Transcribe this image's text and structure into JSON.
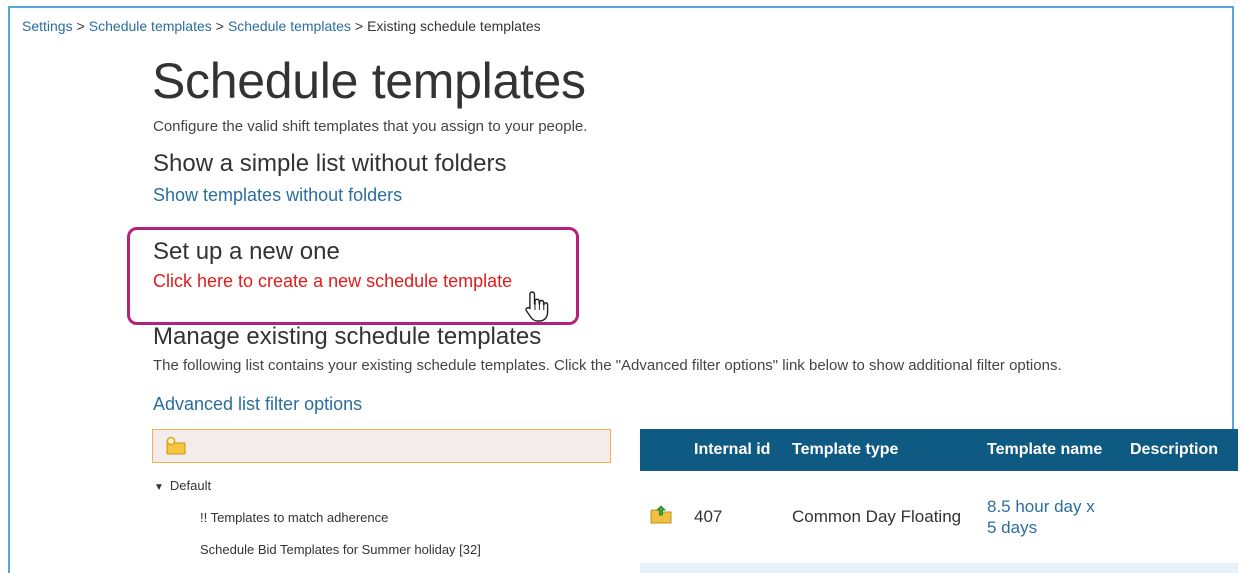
{
  "breadcrumb": {
    "items": [
      "Settings",
      "Schedule templates",
      "Schedule templates"
    ],
    "separator": ">",
    "current": "Existing schedule templates"
  },
  "page": {
    "title": "Schedule templates",
    "subtitle": "Configure the valid shift templates that you assign to your people."
  },
  "simple_list": {
    "heading": "Show a simple list without folders",
    "link": "Show templates without folders"
  },
  "new_one": {
    "heading": "Set up a new one",
    "link": "Click here to create a new schedule template"
  },
  "manage": {
    "heading": "Manage existing schedule templates",
    "description": "The following list contains your existing schedule templates. Click the \"Advanced filter options\" link below to show additional filter options.",
    "filter_link": "Advanced list filter options"
  },
  "tree": {
    "root": "Default",
    "children": [
      "!! Templates to match adherence",
      "Schedule Bid Templates for Summer holiday [32]"
    ]
  },
  "table": {
    "headers": [
      "Internal id",
      "Template type",
      "Template name",
      "Description"
    ],
    "rows": [
      {
        "icon": "folder-arrow-icon",
        "internal_id": "407",
        "template_type": "Common Day Floating",
        "template_name_line1": "8.5 hour day x",
        "template_name_line2": "5 days",
        "description": ""
      }
    ]
  },
  "colors": {
    "link": "#2a6e9e",
    "red_link": "#e21b1b",
    "highlight_border": "#b5207a",
    "table_header": "#0f5a82",
    "folder_bar_border": "#f0b34e"
  }
}
